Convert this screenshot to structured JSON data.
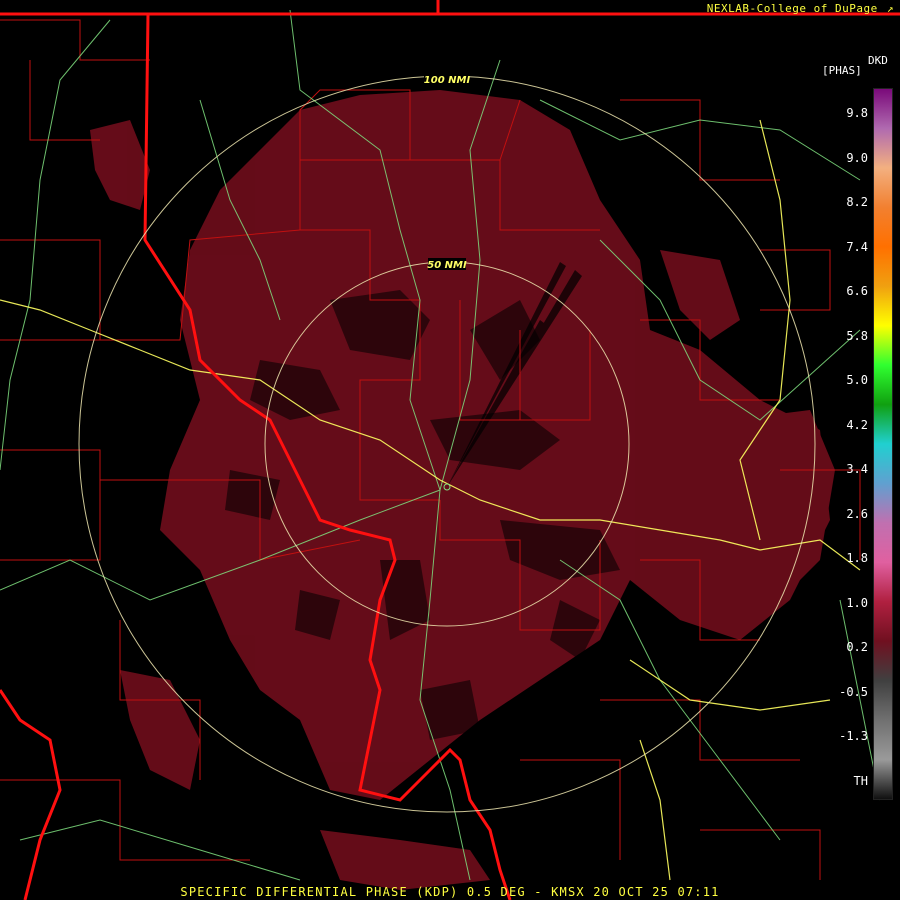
{
  "credit": "NEXLAB-College of DuPage",
  "legend": {
    "title_top": "DKD",
    "title_units": "[PHAS]",
    "ticks": [
      "9.8",
      "9.0",
      "8.2",
      "7.4",
      "6.6",
      "5.8",
      "5.0",
      "4.2",
      "3.4",
      "2.6",
      "1.8",
      "1.0",
      "0.2",
      "-0.5",
      "-1.3",
      "TH"
    ],
    "gradient_colors": [
      "#7a0a7a",
      "#b06ab0",
      "#f3b080",
      "#f28030",
      "#ff7000",
      "#f0a010",
      "#ffff00",
      "#30ff30",
      "#10a010",
      "#20d0d0",
      "#60a0d0",
      "#c070b0",
      "#e060a0",
      "#b02040",
      "#701020",
      "#404040",
      "#707070",
      "#9a9a9a",
      "#101010"
    ]
  },
  "rings": [
    {
      "label": "100 NMI"
    },
    {
      "label": "50 NMI"
    }
  ],
  "caption": "SPECIFIC DIFFERENTIAL PHASE (KDP) 0.5 DEG - KMSX 20 OCT 25 07:11",
  "colors": {
    "echo": "#6a0d1a",
    "echo_dark": "#4a0612",
    "state_border": "#ff1010",
    "county_border": "#c01010",
    "river": "#80e080",
    "highway": "#ffff60",
    "range_ring": "#f0e8b0"
  }
}
